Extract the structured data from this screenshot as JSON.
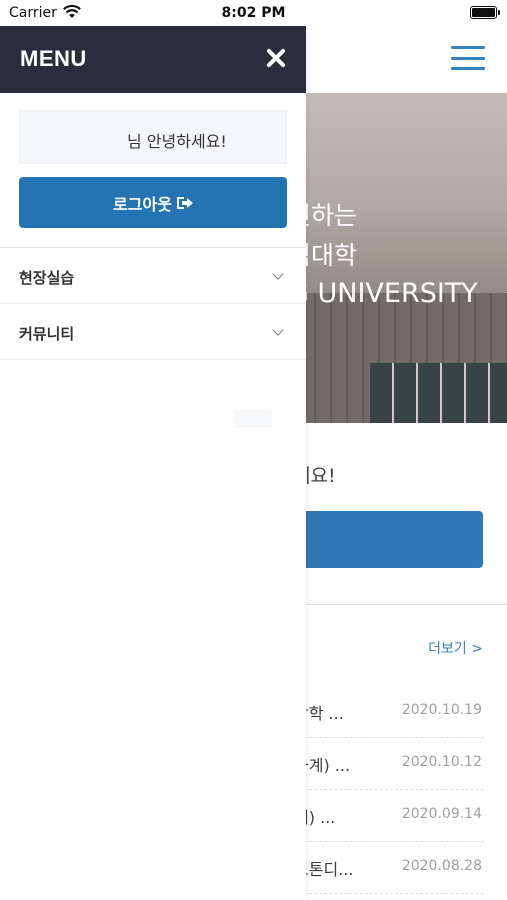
{
  "status_bar": {
    "carrier": "Carrier",
    "time": "8:02 PM"
  },
  "drawer": {
    "title": "MENU",
    "greeting": "님 안녕하세요!",
    "logout_label": "로그아웃",
    "menu_items": [
      {
        "label": "현장실습"
      },
      {
        "label": "커뮤니티"
      }
    ]
  },
  "background": {
    "hero_lines": [
      "인하는",
      "심대학",
      "G UNIVERSITY"
    ],
    "greeting_fragment": "세요!",
    "more_link": "더보기 >",
    "news": [
      {
        "title": "방학 ...",
        "date": "2020.10.19"
      },
      {
        "title": "하계) ...",
        "date": "2020.10.12"
      },
      {
        "title": "계) ...",
        "date": "2020.09.14"
      },
      {
        "title": "노톤디...",
        "date": "2020.08.28"
      }
    ]
  },
  "colors": {
    "drawer_header": "#2b2d3c",
    "primary_button": "#2473b3",
    "accent": "#2a7bbd"
  }
}
